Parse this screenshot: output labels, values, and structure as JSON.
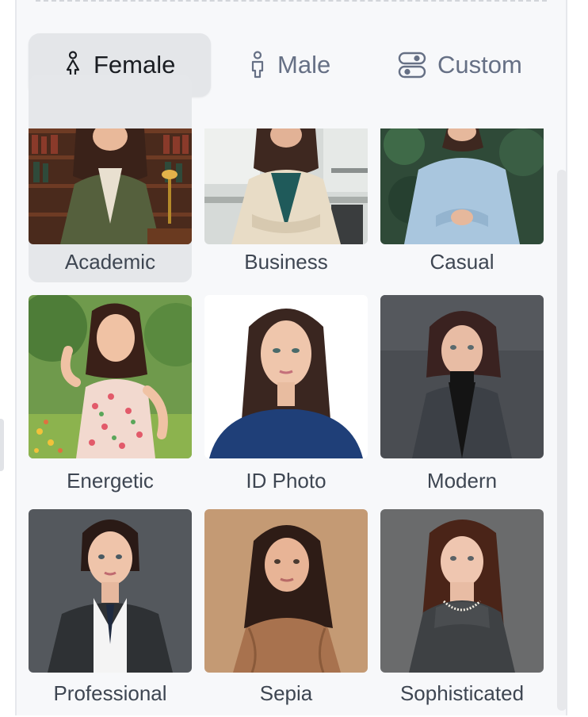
{
  "tabs": [
    {
      "label": "Female",
      "icon": "female-icon",
      "active": true
    },
    {
      "label": "Male",
      "icon": "male-icon",
      "active": false
    },
    {
      "label": "Custom",
      "icon": "custom-toggle-icon",
      "active": false
    }
  ],
  "styles": [
    {
      "label": "Academic",
      "selected": true
    },
    {
      "label": "Business",
      "selected": false
    },
    {
      "label": "Casual",
      "selected": false
    },
    {
      "label": "Energetic",
      "selected": false
    },
    {
      "label": "ID Photo",
      "selected": false
    },
    {
      "label": "Modern",
      "selected": false
    },
    {
      "label": "Professional",
      "selected": false
    },
    {
      "label": "Sepia",
      "selected": false
    },
    {
      "label": "Sophisticated",
      "selected": false
    }
  ],
  "colors": {
    "panel_bg": "#f7f8fa",
    "active_tab_bg": "#e4e6e9",
    "inactive_text": "#667085",
    "label_text": "#3e4652"
  }
}
